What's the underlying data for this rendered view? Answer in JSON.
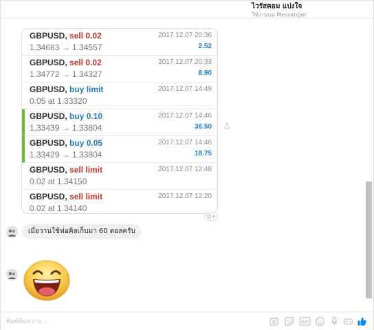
{
  "header": {
    "name": "ไวรัสคอม แบ่งใจ",
    "subtitle": "ใช้งานบน Messenger"
  },
  "trades": [
    {
      "pair": "GBPUSD,",
      "action": "sell 0.02",
      "side": "sell",
      "detail": "1.34683 → 1.34557",
      "time": "2017.12.07 20:36",
      "profit": "2.52",
      "highlighted": false
    },
    {
      "pair": "GBPUSD,",
      "action": "sell 0.02",
      "side": "sell",
      "detail": "1.34772 → 1.34327",
      "time": "2017.12.07 20:33",
      "profit": "8.90",
      "highlighted": false
    },
    {
      "pair": "GBPUSD,",
      "action": "buy limit",
      "side": "buy",
      "detail": "0.05 at 1.33320",
      "time": "2017.12.07 14:49",
      "profit": "",
      "highlighted": false
    },
    {
      "pair": "GBPUSD,",
      "action": "buy 0.10",
      "side": "buy",
      "detail": "1.33439 → 1.33804",
      "time": "2017.12.07 14:46",
      "profit": "36.50",
      "highlighted": true
    },
    {
      "pair": "GBPUSD,",
      "action": "buy 0.05",
      "side": "buy",
      "detail": "1.33429 → 1.33804",
      "time": "2017.12.07 14:46",
      "profit": "18.75",
      "highlighted": true
    },
    {
      "pair": "GBPUSD,",
      "action": "sell limit",
      "side": "sell",
      "detail": "0.02 at 1.34150",
      "time": "2017.12.07 12:48",
      "profit": "",
      "highlighted": false
    },
    {
      "pair": "GBPUSD,",
      "action": "sell limit",
      "side": "sell",
      "detail": "0.02 at 1.34140",
      "time": "2017.12.07 12:20",
      "profit": "",
      "highlighted": false
    }
  ],
  "message": {
    "text": "เมื่อวานใช้ฟอคิลเก็บมา 60 ดอลครับ"
  },
  "composer": {
    "placeholder": "พิมพ์ข้อความ..."
  },
  "icons": {
    "sticker_search": "sticker-icon",
    "emoji_sticker": "smiley-sticker-icon",
    "gif": "gif-icon",
    "emoji": "emoji-icon",
    "mic": "microphone-icon",
    "game": "game-icon",
    "like": "thumbs-up-icon"
  },
  "colors": {
    "sell": "#c0392b",
    "buy": "#2a7ab8",
    "profit": "#1f7fc8",
    "highlight_bar": "#6fb83b",
    "like": "#0084ff"
  }
}
